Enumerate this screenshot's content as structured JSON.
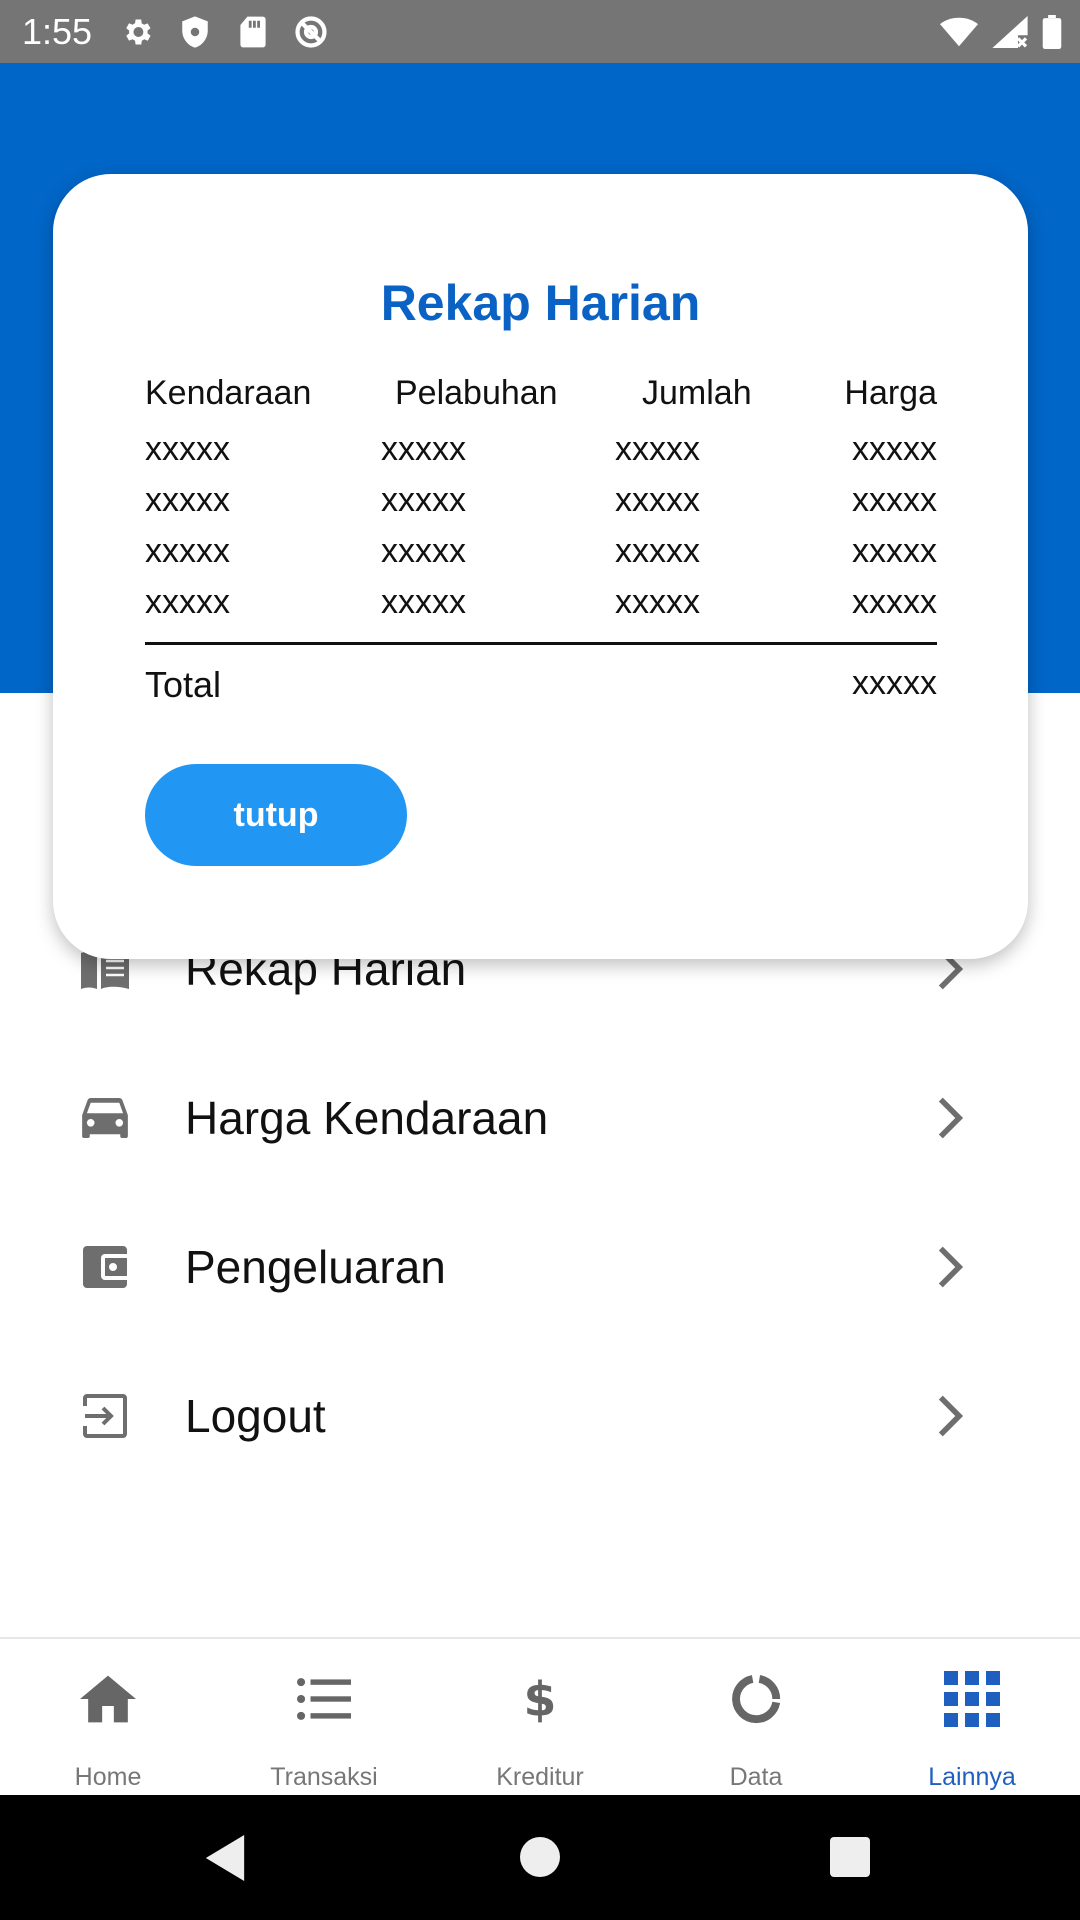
{
  "status_bar": {
    "time": "1:55",
    "left_icons": [
      "settings-gear-icon",
      "shield-icon",
      "sd-card-icon",
      "at-sign-icon"
    ],
    "right_icons": [
      "wifi-icon",
      "cell-signal-icon",
      "battery-icon"
    ]
  },
  "dialog": {
    "title": "Rekap Harian",
    "columns": [
      "Kendaraan",
      "Pelabuhan",
      "Jumlah",
      "Harga"
    ],
    "rows": [
      [
        "xxxxx",
        "xxxxx",
        "xxxxx",
        "xxxxx"
      ],
      [
        "xxxxx",
        "xxxxx",
        "xxxxx",
        "xxxxx"
      ],
      [
        "xxxxx",
        "xxxxx",
        "xxxxx",
        "xxxxx"
      ],
      [
        "xxxxx",
        "xxxxx",
        "xxxxx",
        "xxxxx"
      ]
    ],
    "total_label": "Total",
    "total_value": "xxxxx",
    "close_button": "tutup"
  },
  "menu": {
    "items": [
      {
        "label": "Rekap Harian",
        "icon": "book-icon"
      },
      {
        "label": "Harga Kendaraan",
        "icon": "car-icon"
      },
      {
        "label": "Pengeluaran",
        "icon": "wallet-icon"
      },
      {
        "label": "Logout",
        "icon": "logout-icon"
      }
    ]
  },
  "bottom_nav": {
    "items": [
      {
        "label": "Home",
        "icon": "home-icon"
      },
      {
        "label": "Transaksi",
        "icon": "list-icon"
      },
      {
        "label": "Kreditur",
        "icon": "dollar-icon"
      },
      {
        "label": "Data",
        "icon": "donut-chart-icon"
      },
      {
        "label": "Lainnya",
        "icon": "grid-apps-icon"
      }
    ],
    "active": "Lainnya"
  },
  "colors": {
    "header_blue": "#0066c8",
    "title_blue": "#0a63c4",
    "button_blue": "#2196f3",
    "active_nav": "#1e5fc0",
    "status_bar": "#757575"
  }
}
